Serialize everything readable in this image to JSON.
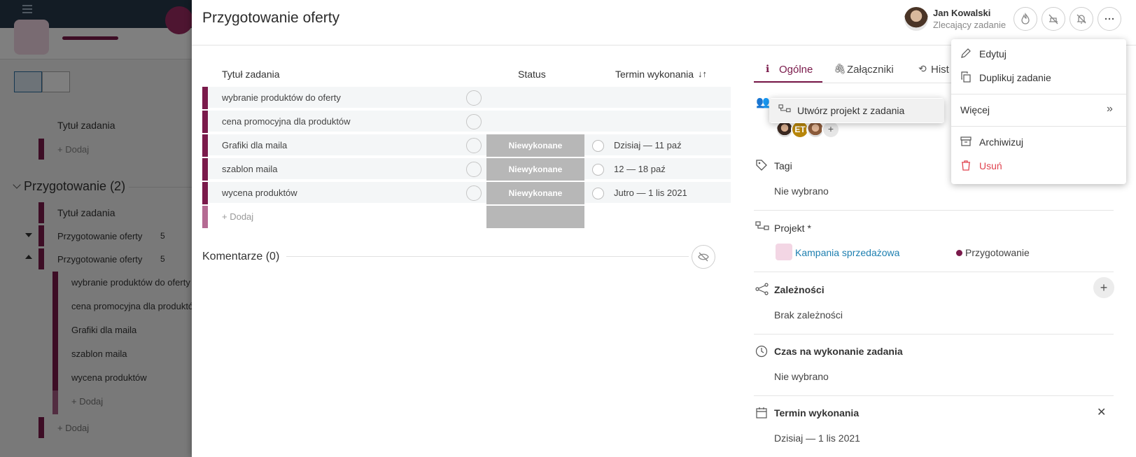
{
  "colors": {
    "accent": "#7a1a4b",
    "link": "#1d7fb0",
    "danger": "#e0434f",
    "status_gray": "#b7b7b7"
  },
  "background": {
    "table_header": "Tytuł zadania",
    "add_label": "+ Dodaj",
    "group_title": "Przygotowanie (2)",
    "group_header": "Tytuł zadania",
    "rows": [
      {
        "label": "Przygotowanie oferty",
        "count": "5"
      },
      {
        "label": "Przygotowanie oferty",
        "count": "5"
      }
    ],
    "subtasks": [
      "wybranie produktów do oferty",
      "cena promocyjna dla produktów",
      "Grafiki dla maila",
      "szablon maila",
      "wycena produktów"
    ],
    "sub_add": "+ Dodaj",
    "bottom_add": "+ Dodaj"
  },
  "drawer": {
    "title": "Przygotowanie oferty",
    "user": {
      "name": "Jan Kowalski",
      "role": "Zlecający zadanie"
    },
    "table": {
      "headers": {
        "title": "Tytuł zadania",
        "status": "Status",
        "deadline": "Termin wykonania"
      },
      "rows": [
        {
          "name": "wybranie produktów do oferty",
          "status": "",
          "date": ""
        },
        {
          "name": "cena promocyjna dla produktów",
          "status": "",
          "date": ""
        },
        {
          "name": "Grafiki dla maila",
          "status": "Niewykonane",
          "date": "Dzisiaj — 11 paź"
        },
        {
          "name": "szablon maila",
          "status": "Niewykonane",
          "date": "12 — 18 paź"
        },
        {
          "name": "wycena produktów",
          "status": "Niewykonane",
          "date": "Jutro — 1 lis 2021"
        }
      ],
      "add_label": "+ Dodaj"
    },
    "comments_label": "Komentarze (0)",
    "tabs": [
      {
        "label": "Ogólne",
        "active": true
      },
      {
        "label": "Załączniki",
        "active": false
      },
      {
        "label": "Hist",
        "active": false
      }
    ],
    "people": {
      "initials": "ET",
      "add": "+"
    },
    "sections": {
      "tags": {
        "title": "Tagi",
        "value": "Nie wybrano"
      },
      "project": {
        "title": "Projekt *",
        "project_name": "Kampania sprzedażowa",
        "stage": "Przygotowanie"
      },
      "dependencies": {
        "title": "Zależności",
        "value": "Brak zależności"
      },
      "time": {
        "title": "Czas na wykonanie zadania",
        "value": "Nie wybrano"
      },
      "deadline": {
        "title": "Termin wykonania",
        "value": "Dzisiaj — 1 lis 2021"
      }
    }
  },
  "menu": {
    "items": [
      {
        "label": "Edytuj",
        "icon": "pencil-icon"
      },
      {
        "label": "Duplikuj zadanie",
        "icon": "copy-icon"
      },
      {
        "label": "Więcej",
        "icon": "double-chevron-right-icon"
      },
      {
        "label": "Archiwizuj",
        "icon": "archive-icon"
      },
      {
        "label": "Usuń",
        "icon": "trash-icon"
      }
    ]
  },
  "submenu": {
    "label": "Utwórz projekt z zadania",
    "icon": "project-tree-icon"
  }
}
